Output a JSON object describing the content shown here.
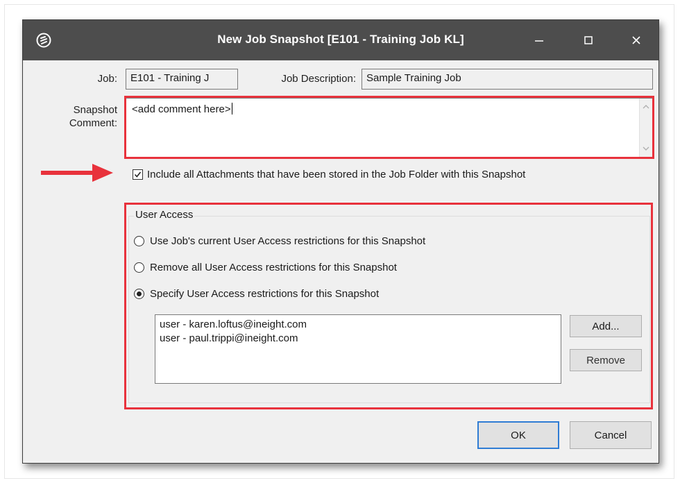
{
  "window": {
    "title": "New Job Snapshot [E101 - Training Job KL]",
    "controls": {
      "minimize": "minimize-icon",
      "maximize": "maximize-icon",
      "close": "close-icon"
    }
  },
  "form": {
    "job_label": "Job:",
    "job_value": "E101 - Training J",
    "job_description_label": "Job Description:",
    "job_description_value": "Sample Training Job",
    "snapshot_label_line1": "Snapshot",
    "snapshot_label_line2": "Comment:",
    "snapshot_comment_value": "<add comment here>",
    "include_attachments_label": "Include all Attachments that have been stored in the Job Folder with this Snapshot",
    "include_attachments_checked": true
  },
  "user_access": {
    "group_label": "User Access",
    "options": [
      {
        "label": "Use Job's current User Access restrictions for this Snapshot",
        "selected": false
      },
      {
        "label": "Remove all User Access restrictions for this Snapshot",
        "selected": false
      },
      {
        "label": "Specify User Access restrictions for this Snapshot",
        "selected": true
      }
    ],
    "users": [
      "user - karen.loftus@ineight.com",
      "user - paul.trippi@ineight.com"
    ],
    "add_label": "Add...",
    "remove_label": "Remove"
  },
  "footer": {
    "ok_label": "OK",
    "cancel_label": "Cancel"
  },
  "colors": {
    "titlebar": "#4d4d4d",
    "highlight": "#e8323c",
    "focus": "#2f7cd4",
    "dialog_bg": "#f0f0f0"
  }
}
